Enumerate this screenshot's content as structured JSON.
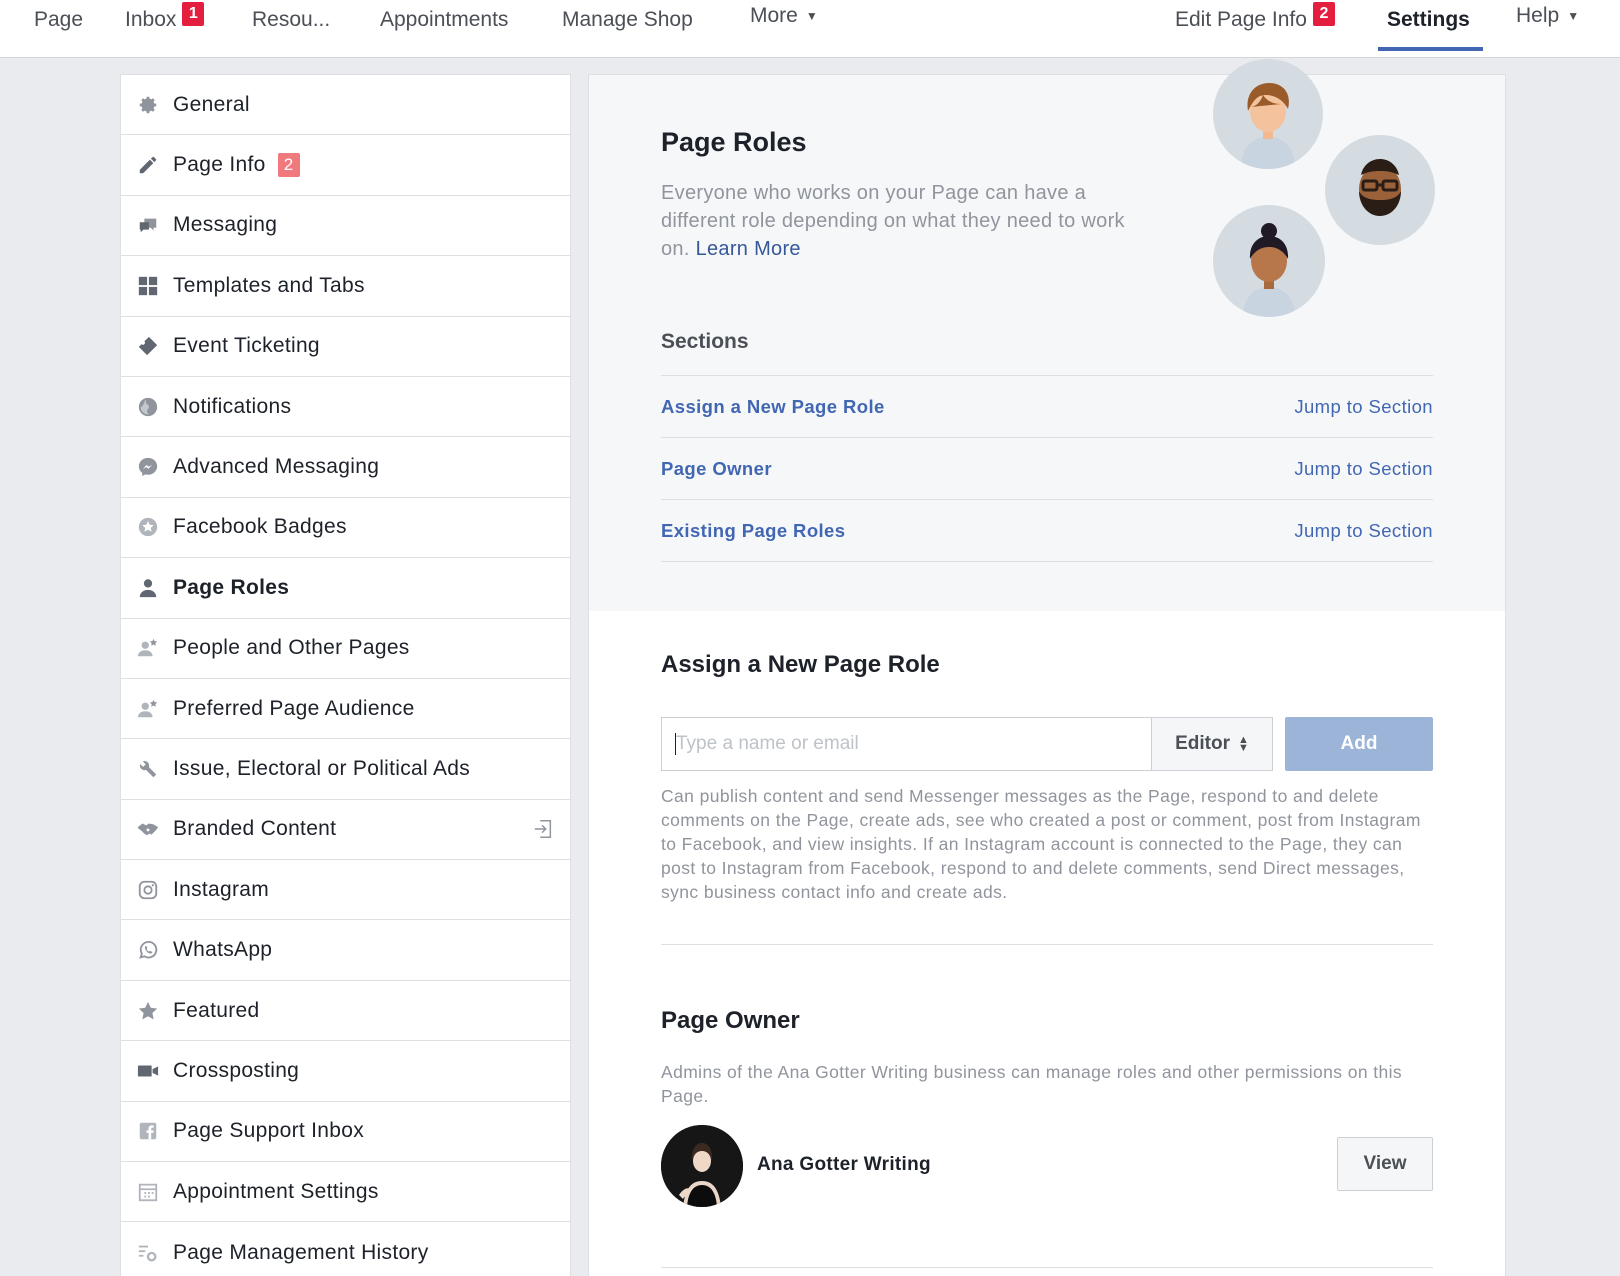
{
  "topnav": {
    "items": [
      {
        "label": "Page"
      },
      {
        "label": "Inbox",
        "badge": "1"
      },
      {
        "label": "Resou..."
      },
      {
        "label": "Appointments"
      },
      {
        "label": "Manage Shop"
      },
      {
        "label": "More"
      },
      {
        "label": "Edit Page Info",
        "badge": "2"
      },
      {
        "label": "Settings"
      },
      {
        "label": "Help"
      }
    ],
    "active": "Settings"
  },
  "sidebar": {
    "items": [
      {
        "label": "General",
        "icon": "gear-icon"
      },
      {
        "label": "Page Info",
        "icon": "pencil-icon",
        "badge": "2"
      },
      {
        "label": "Messaging",
        "icon": "chat-bubbles-icon"
      },
      {
        "label": "Templates and Tabs",
        "icon": "grid-icon"
      },
      {
        "label": "Event Ticketing",
        "icon": "ticket-icon"
      },
      {
        "label": "Notifications",
        "icon": "globe-icon"
      },
      {
        "label": "Advanced Messaging",
        "icon": "messenger-icon"
      },
      {
        "label": "Facebook Badges",
        "icon": "badge-star-icon"
      },
      {
        "label": "Page Roles",
        "icon": "person-icon",
        "active": true
      },
      {
        "label": "People and Other Pages",
        "icon": "person-star-icon"
      },
      {
        "label": "Preferred Page Audience",
        "icon": "person-star-icon"
      },
      {
        "label": "Issue, Electoral or Political Ads",
        "icon": "wrench-icon"
      },
      {
        "label": "Branded Content",
        "icon": "handshake-icon",
        "extra_icon": "external-link-icon"
      },
      {
        "label": "Instagram",
        "icon": "instagram-icon"
      },
      {
        "label": "WhatsApp",
        "icon": "whatsapp-icon"
      },
      {
        "label": "Featured",
        "icon": "star-icon"
      },
      {
        "label": "Crossposting",
        "icon": "video-camera-icon"
      },
      {
        "label": "Page Support Inbox",
        "icon": "facebook-icon"
      },
      {
        "label": "Appointment Settings",
        "icon": "calendar-icon"
      },
      {
        "label": "Page Management History",
        "icon": "list-gear-icon"
      }
    ]
  },
  "hero": {
    "title": "Page Roles",
    "description": "Everyone who works on your Page can have a different role depending on what they need to work on.",
    "learn_more": "Learn More"
  },
  "sections": {
    "title": "Sections",
    "rows": [
      {
        "name": "Assign a New Page Role",
        "jump": "Jump to Section"
      },
      {
        "name": "Page Owner",
        "jump": "Jump to Section"
      },
      {
        "name": "Existing Page Roles",
        "jump": "Jump to Section"
      }
    ]
  },
  "assign": {
    "title": "Assign a New Page Role",
    "input_placeholder": "Type a name or email",
    "role_value": "Editor",
    "add_label": "Add",
    "description": "Can publish content and send Messenger messages as the Page, respond to and delete comments on the Page, create ads, see who created a post or comment, post from Instagram to Facebook, and view insights. If an Instagram account is connected to the Page, they can post to Instagram from Facebook, respond to and delete comments, send Direct messages, sync business contact info and create ads."
  },
  "owner": {
    "title": "Page Owner",
    "description": "Admins of the Ana Gotter Writing business can manage roles and other permissions on this Page.",
    "name": "Ana Gotter Writing",
    "view_label": "View"
  },
  "colors": {
    "accent": "#4267b2",
    "badge_red": "#e41e3f",
    "add_button_disabled": "#9cb4d8"
  }
}
